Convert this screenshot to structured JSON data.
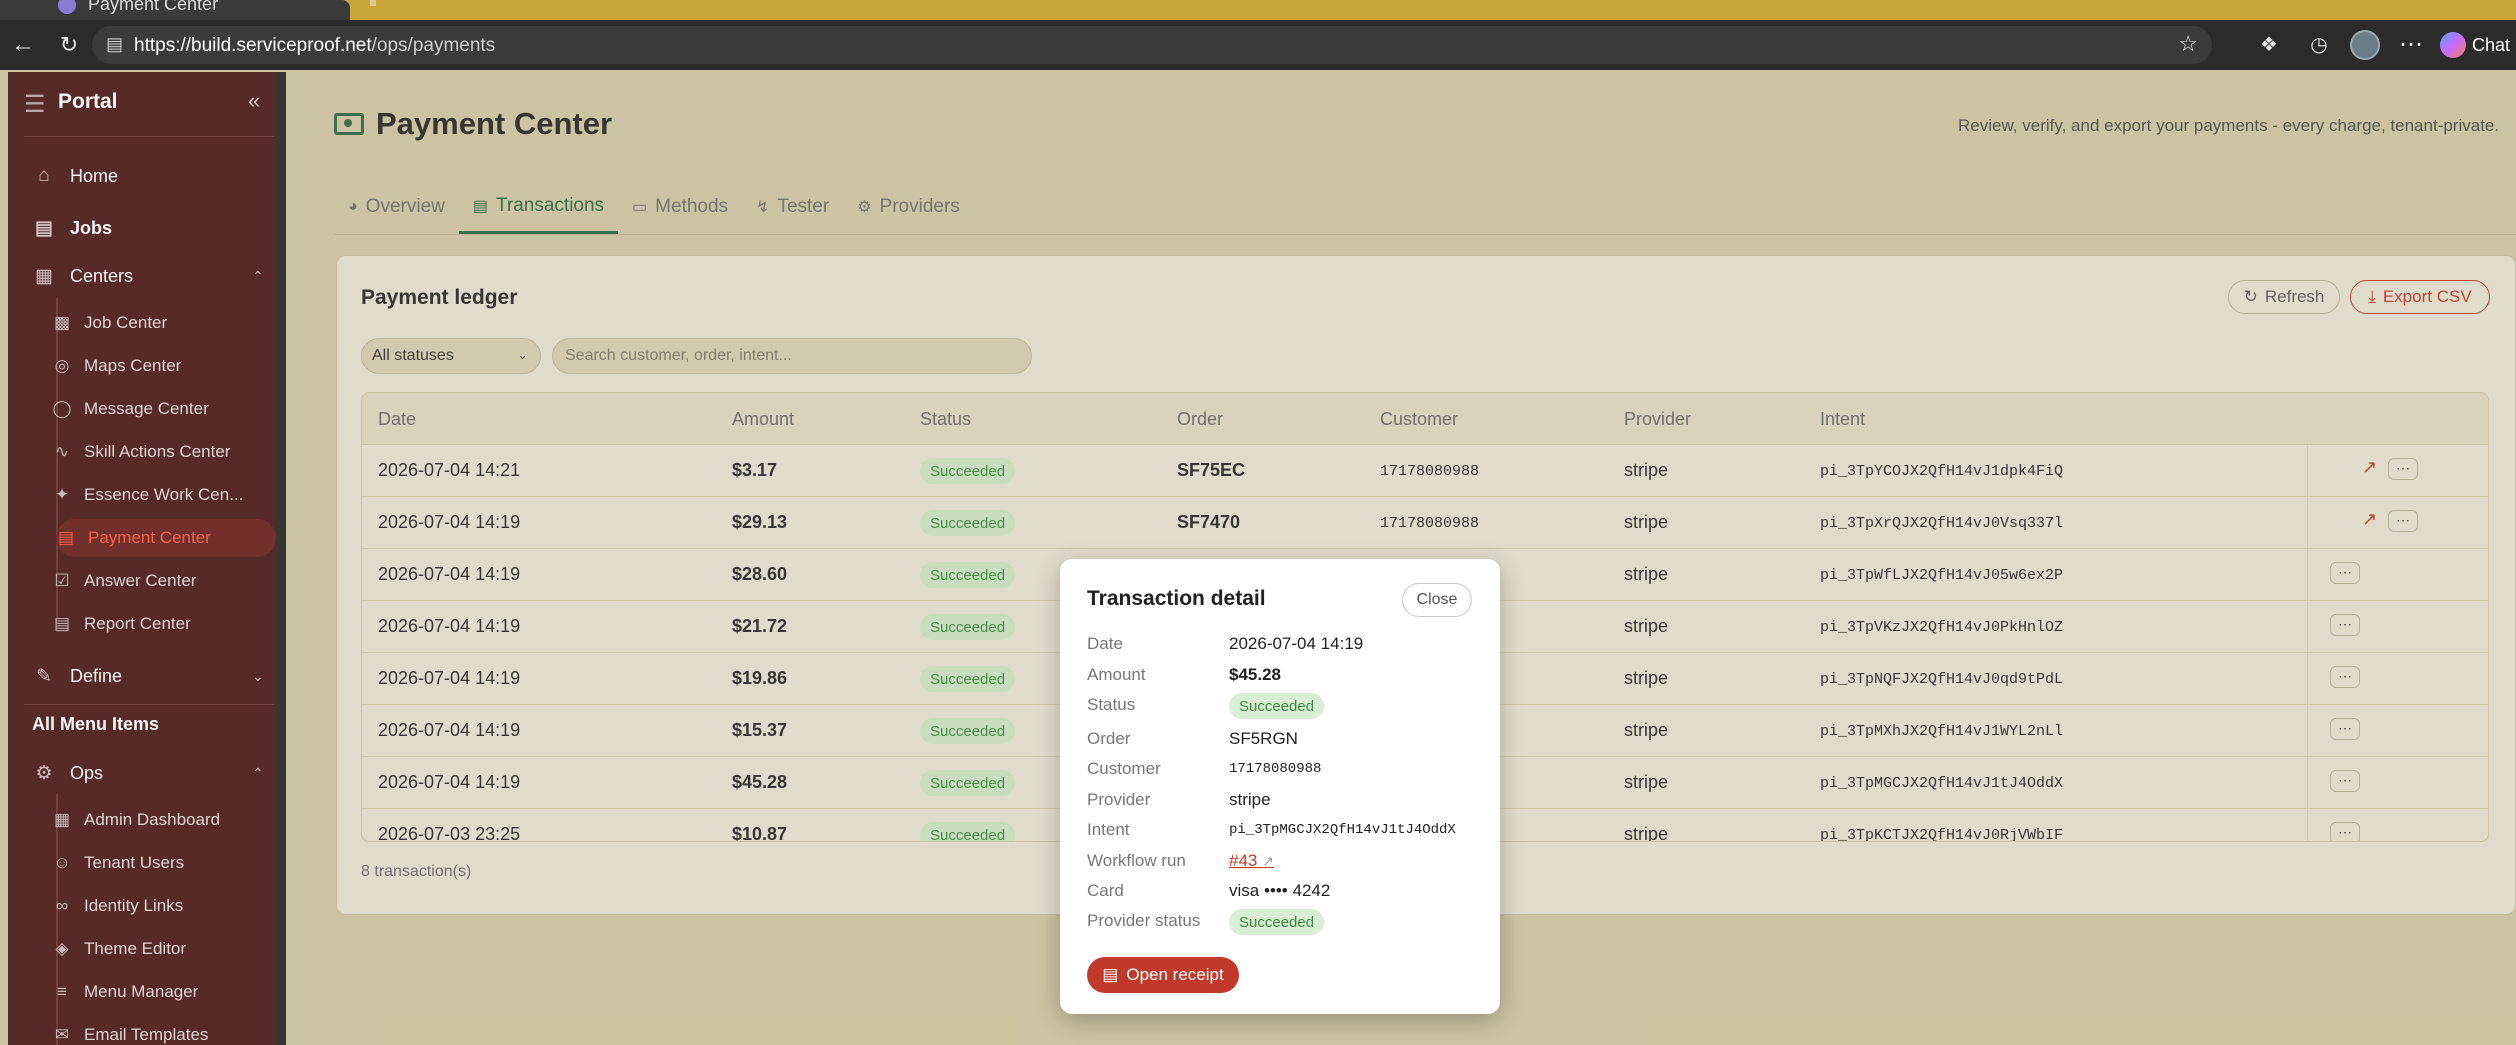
{
  "browser": {
    "tab_title": "Payment Center",
    "url_host": "https://build.serviceproof.net",
    "url_path": "/ops/payments",
    "chat_label": "Chat"
  },
  "sidebar": {
    "title": "Portal",
    "items": {
      "home": "Home",
      "jobs": "Jobs",
      "centers": "Centers",
      "define": "Define",
      "all_menu_items": "All Menu Items",
      "ops": "Ops"
    },
    "centers_sub": [
      "Job Center",
      "Maps Center",
      "Message Center",
      "Skill Actions Center",
      "Essence Work Cen...",
      "Payment Center",
      "Answer Center",
      "Report Center"
    ],
    "ops_sub": [
      "Admin Dashboard",
      "Tenant Users",
      "Identity Links",
      "Theme Editor",
      "Menu Manager",
      "Email Templates"
    ]
  },
  "header": {
    "title": "Payment Center",
    "subtitle": "Review, verify, and export your payments - every charge, tenant-private."
  },
  "tabs": [
    "Overview",
    "Transactions",
    "Methods",
    "Tester",
    "Providers"
  ],
  "ledger": {
    "title": "Payment ledger",
    "refresh_label": "Refresh",
    "export_label": "Export CSV",
    "status_filter": "All statuses",
    "search_placeholder": "Search customer, order, intent...",
    "columns": [
      "Date",
      "Amount",
      "Status",
      "Order",
      "Customer",
      "Provider",
      "Intent"
    ],
    "rows": [
      {
        "date": "2026-07-04 14:21",
        "amount": "$3.17",
        "status": "Succeeded",
        "order": "SF75EC",
        "customer": "17178080988",
        "provider": "stripe",
        "intent": "pi_3TpYCOJX2QfH14vJ1dpk4FiQ"
      },
      {
        "date": "2026-07-04 14:19",
        "amount": "$29.13",
        "status": "Succeeded",
        "order": "SF7470",
        "customer": "17178080988",
        "provider": "stripe",
        "intent": "pi_3TpXrQJX2QfH14vJ0Vsq337l"
      },
      {
        "date": "2026-07-04 14:19",
        "amount": "$28.60",
        "status": "Succeeded",
        "order": "",
        "customer": "",
        "provider": "stripe",
        "intent": "pi_3TpWfLJX2QfH14vJ05w6ex2P"
      },
      {
        "date": "2026-07-04 14:19",
        "amount": "$21.72",
        "status": "Succeeded",
        "order": "",
        "customer": "",
        "provider": "stripe",
        "intent": "pi_3TpVKzJX2QfH14vJ0PkHnlOZ"
      },
      {
        "date": "2026-07-04 14:19",
        "amount": "$19.86",
        "status": "Succeeded",
        "order": "",
        "customer": "",
        "provider": "stripe",
        "intent": "pi_3TpNQFJX2QfH14vJ0qd9tPdL"
      },
      {
        "date": "2026-07-04 14:19",
        "amount": "$15.37",
        "status": "Succeeded",
        "order": "",
        "customer": "",
        "provider": "stripe",
        "intent": "pi_3TpMXhJX2QfH14vJ1WYL2nLl"
      },
      {
        "date": "2026-07-04 14:19",
        "amount": "$45.28",
        "status": "Succeeded",
        "order": "",
        "customer": "",
        "provider": "stripe",
        "intent": "pi_3TpMGCJX2QfH14vJ1tJ4OddX"
      },
      {
        "date": "2026-07-03 23:25",
        "amount": "$10.87",
        "status": "Succeeded",
        "order": "",
        "customer": "",
        "provider": "stripe",
        "intent": "pi_3TpKCTJX2QfH14vJ0RjVWbIF"
      }
    ],
    "count_label": "8 transaction(s)"
  },
  "modal": {
    "title": "Transaction detail",
    "close_label": "Close",
    "labels": {
      "date": "Date",
      "amount": "Amount",
      "status": "Status",
      "order": "Order",
      "customer": "Customer",
      "provider": "Provider",
      "intent": "Intent",
      "workflow_run": "Workflow run",
      "card": "Card",
      "provider_status": "Provider status"
    },
    "values": {
      "date": "2026-07-04 14:19",
      "amount": "$45.28",
      "status": "Succeeded",
      "order": "SF5RGN",
      "customer": "17178080988",
      "provider": "stripe",
      "intent": "pi_3TpMGCJX2QfH14vJ1tJ4OddX",
      "workflow_run": "#43",
      "card": "visa •••• 4242",
      "provider_status": "Succeeded"
    },
    "receipt_label": "Open receipt"
  },
  "colors": {
    "sidebar_bg": "#4c1d1d",
    "accent_green": "#2e6a45",
    "accent_red": "#c0392b",
    "success_badge": "#cce4c7"
  }
}
